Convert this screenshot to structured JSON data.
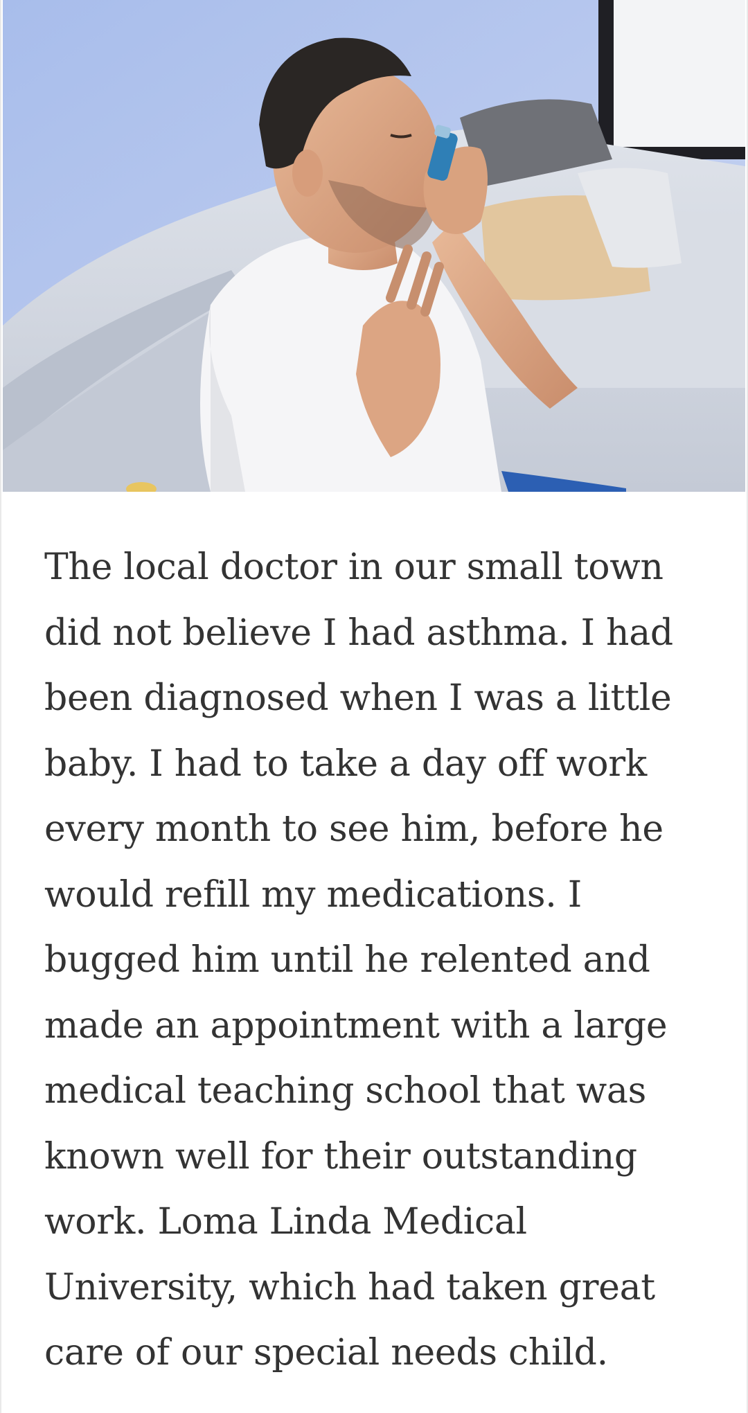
{
  "hero_image": {
    "alt": "Man using an asthma inhaler while seated on a light grey sofa",
    "icon": "photo-inhaler"
  },
  "article": {
    "paragraph": "The local doctor in our small town did not believe I had asthma. I had been diagnosed when I was a little baby. I had to take a day off work every month to see him, before he would refill my medications. I bugged him until he relented and made an appointment with a large medical teaching school that was known well for their outstanding work. Loma Linda Medical University, which had taken great care of our special needs child."
  },
  "colors": {
    "wall": "#b8c8ee",
    "sofa": "#d3d8e2",
    "shirt": "#f4f4f6",
    "inhaler": "#2f7fb6",
    "text": "#333333"
  }
}
